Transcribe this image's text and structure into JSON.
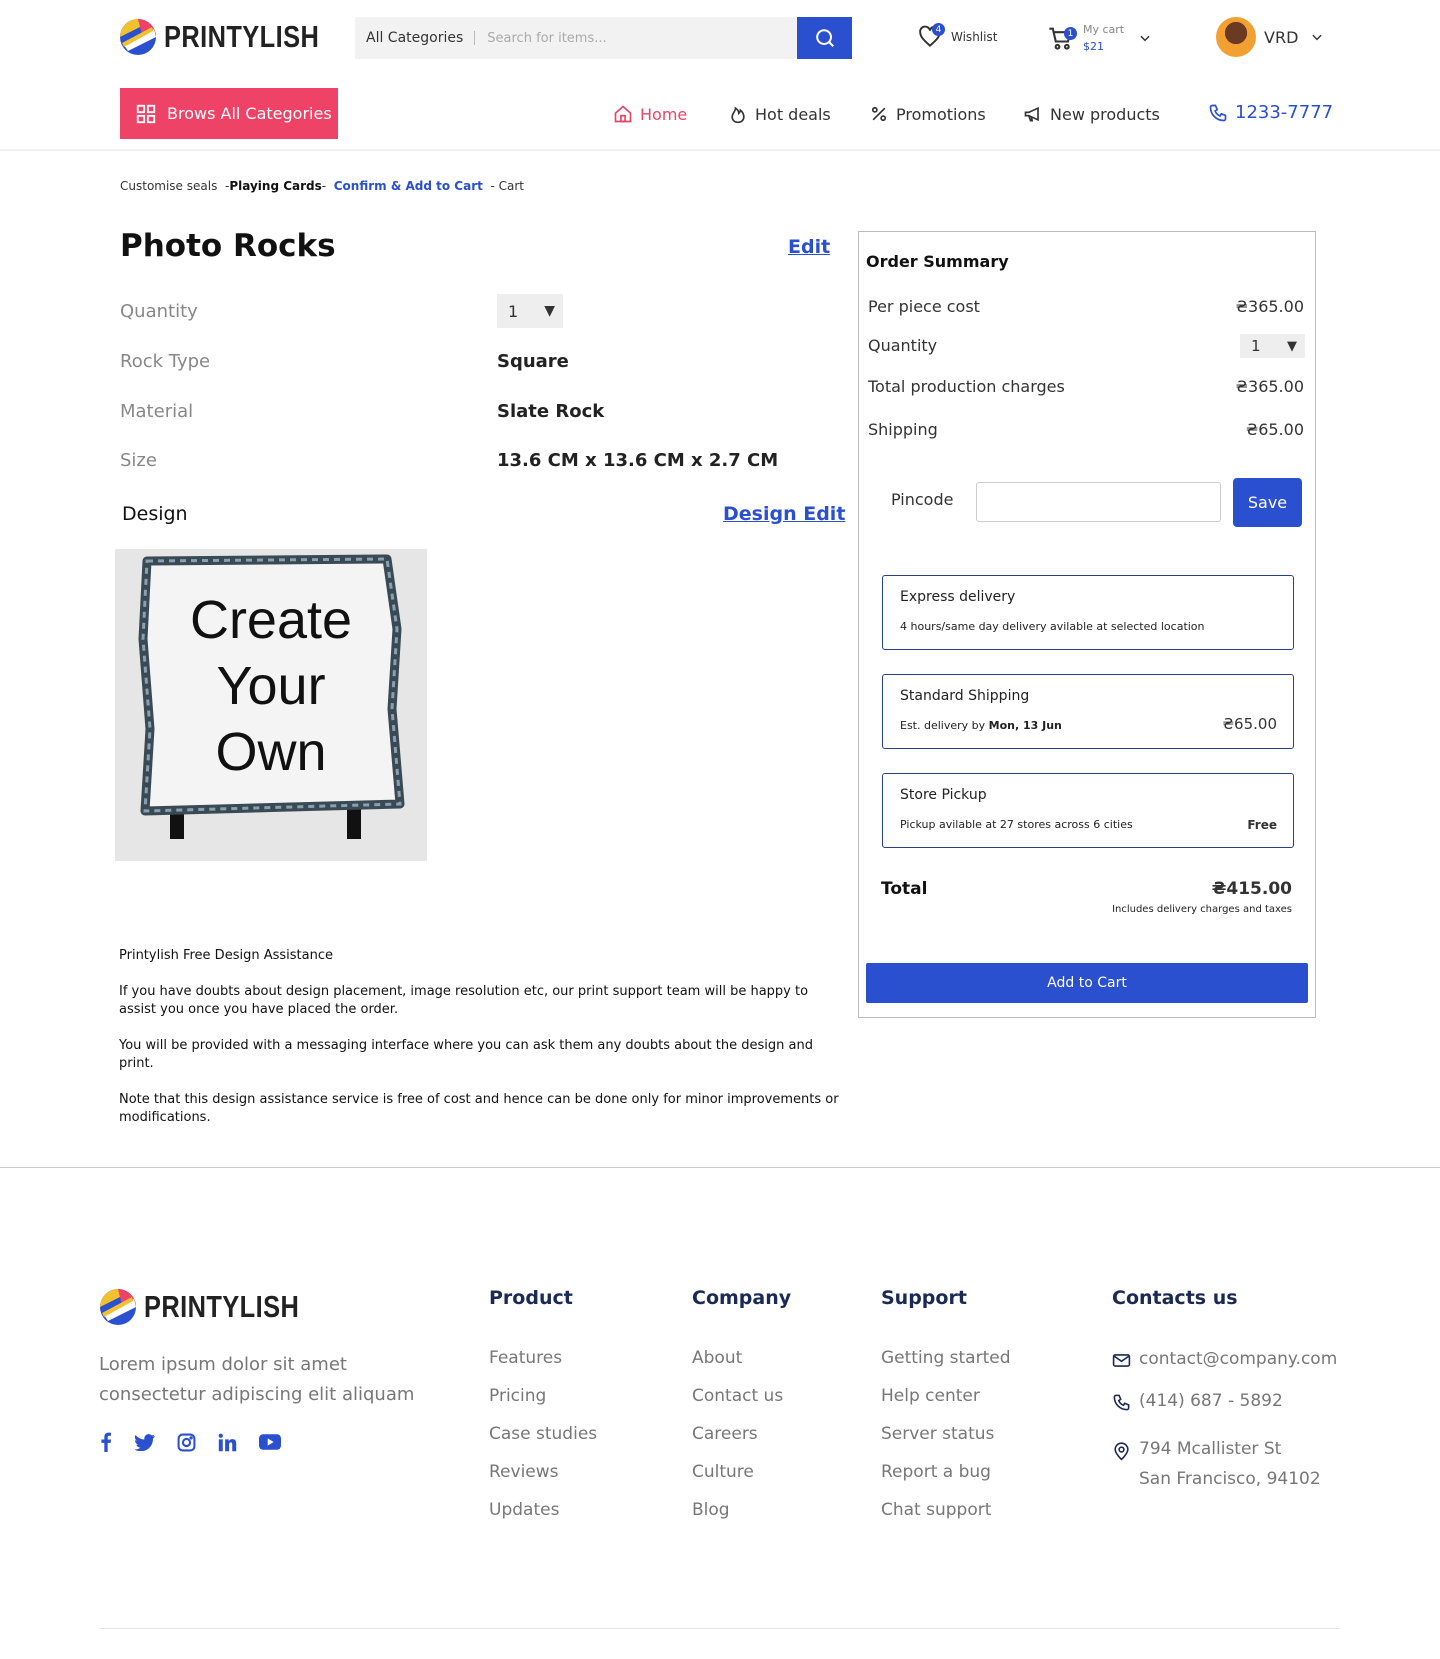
{
  "brand": {
    "name": "PRINTYLISH"
  },
  "header": {
    "search_category": "All Categories",
    "search_placeholder": "Search for items...",
    "wishlist_label": "Wishlist",
    "wishlist_count": "4",
    "cart_label": "My cart",
    "cart_amount": "$21",
    "cart_count": "1",
    "user_name": "VRD"
  },
  "nav": {
    "browse_label": "Brows All Categories",
    "items": [
      {
        "label": "Home",
        "color": "#ee4266"
      },
      {
        "label": "Hot deals"
      },
      {
        "label": "Promotions"
      },
      {
        "label": "New products"
      }
    ],
    "phone": "1233-7777"
  },
  "breadcrumb": {
    "step1": "Customise seals",
    "step2": "Playing Cards",
    "step3": "Confirm & Add to Cart",
    "step4": "Cart"
  },
  "product": {
    "title": "Photo Rocks",
    "edit_label": "Edit",
    "fields": [
      {
        "label": "Quantity",
        "value": "1"
      },
      {
        "label": "Rock Type",
        "value": "Square"
      },
      {
        "label": "Material",
        "value": "Slate Rock"
      },
      {
        "label": "Size",
        "value": "13.6 CM x 13.6 CM x 2.7 CM"
      }
    ],
    "design_label": "Design",
    "design_edit_label": "Design Edit",
    "design_image_text": [
      "Create",
      "Your",
      "Own"
    ]
  },
  "assistance": {
    "heading": "Printylish Free Design Assistance",
    "para1": "If you have doubts about design placement, image resolution etc, our print support team will be happy to assist you once you have placed the order.",
    "para2": "You will be provided with a messaging interface where you can ask them any doubts about the design and print.",
    "para3": "Note that this design assistance service is free of cost and hence can be done only for minor improvements or modifications."
  },
  "summary": {
    "title": "Order Summary",
    "per_piece_label": "Per piece cost",
    "per_piece_value": "₴365.00",
    "quantity_label": "Quantity",
    "quantity_value": "1",
    "production_label": "Total production charges",
    "production_value": "₴365.00",
    "shipping_label": "Shipping",
    "shipping_value": "₴65.00",
    "pincode_label": "Pincode",
    "pincode_value": "",
    "save_label": "Save",
    "options": [
      {
        "title": "Express delivery",
        "desc": "4 hours/same day delivery avilable at selected location",
        "price": ""
      },
      {
        "title": "Standard Shipping",
        "desc_prefix": "Est. delivery by ",
        "desc_bold": "Mon, 13 Jun",
        "price": "₴65.00"
      },
      {
        "title": "Store Pickup",
        "desc": "Pickup avilable at 27 stores across 6 cities",
        "price": "Free"
      }
    ],
    "total_label": "Total",
    "total_value": "₴415.00",
    "total_note": "Includes delivery charges and taxes",
    "add_to_cart_label": "Add to Cart"
  },
  "footer": {
    "description": "Lorem ipsum dolor sit amet consectetur adipiscing elit aliquam",
    "columns": [
      {
        "heading": "Product",
        "links": [
          "Features",
          "Pricing",
          "Case studies",
          "Reviews",
          "Updates"
        ]
      },
      {
        "heading": "Company",
        "links": [
          "About",
          "Contact us",
          "Careers",
          "Culture",
          "Blog"
        ]
      },
      {
        "heading": "Support",
        "links": [
          "Getting started",
          "Help center",
          "Server status",
          "Report a bug",
          "Chat support"
        ]
      }
    ],
    "contacts_heading": "Contacts us",
    "email": "contact@company.com",
    "phone": "(414) 687 - 5892",
    "address_line1": "794 Mcallister St",
    "address_line2": "San Francisco, 94102",
    "social": [
      "facebook-icon",
      "twitter-icon",
      "instagram-icon",
      "linkedin-icon",
      "youtube-icon"
    ]
  },
  "colors": {
    "primary": "#2a4fcf",
    "accent": "#ee4266",
    "footer_heading": "#1a2a55"
  }
}
